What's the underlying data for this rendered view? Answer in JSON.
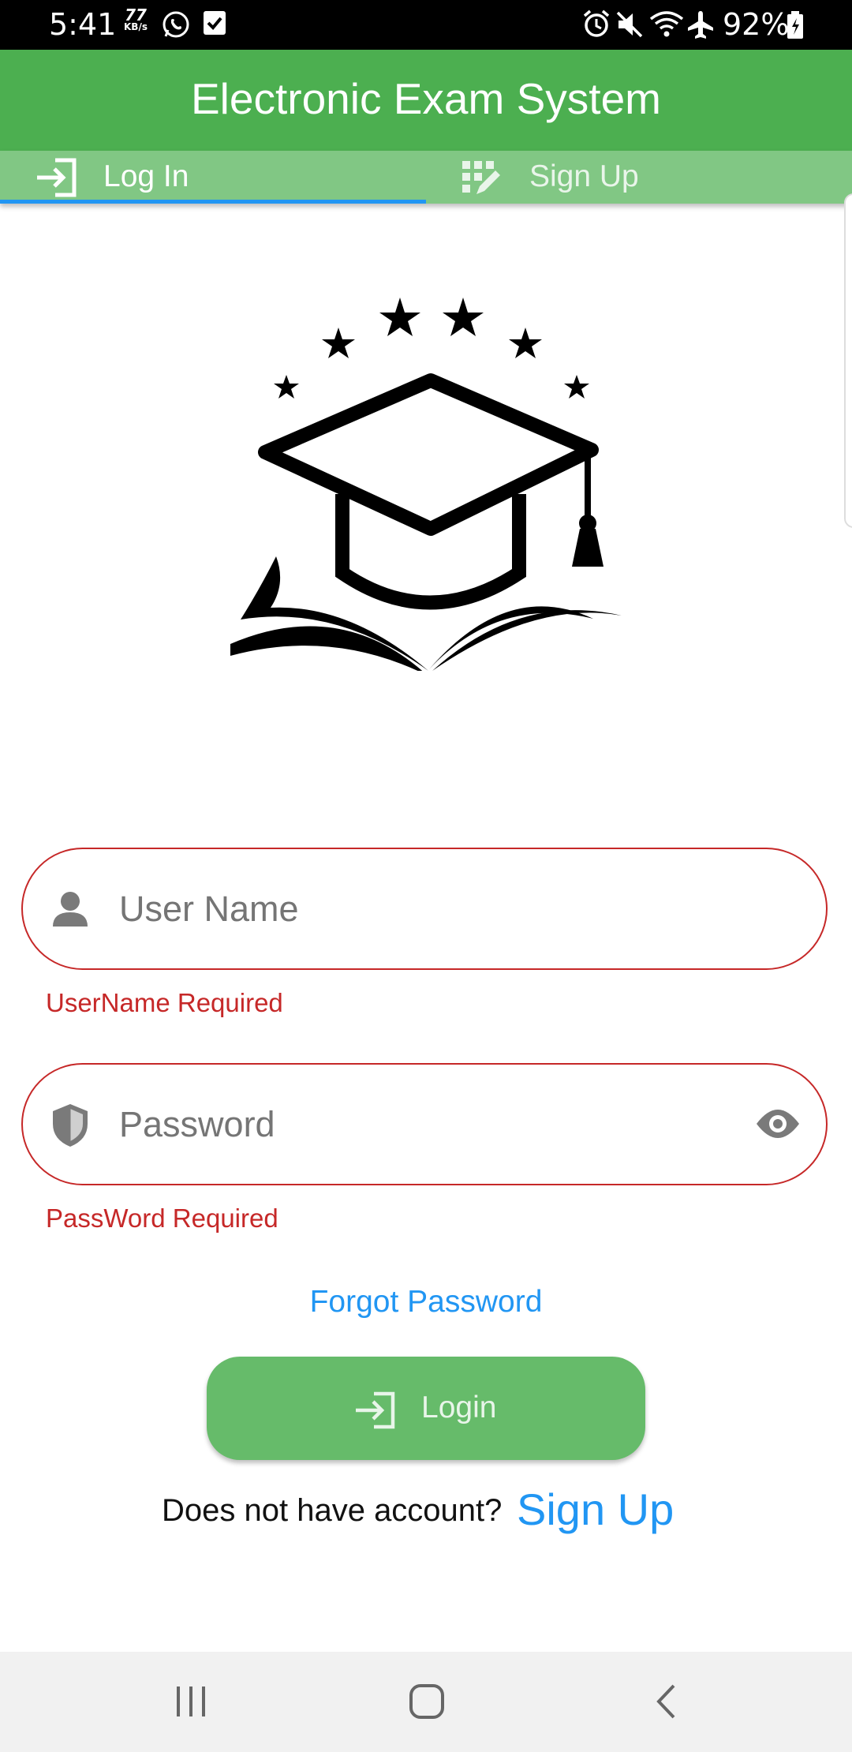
{
  "status_bar": {
    "time": "5:41",
    "net_speed_value": "77",
    "net_speed_unit": "KB/s",
    "battery_percent": "92%"
  },
  "app_bar": {
    "title": "Electronic Exam System"
  },
  "tabs": [
    {
      "label": "Log In",
      "icon": "login-icon",
      "selected": true
    },
    {
      "label": "Sign Up",
      "icon": "app-registration-icon",
      "selected": false
    }
  ],
  "form": {
    "username": {
      "placeholder": "User Name",
      "value": "",
      "error": "UserName Required"
    },
    "password": {
      "placeholder": "Password",
      "value": "",
      "error": "PassWord Required"
    },
    "forgot_label": "Forgot Password",
    "login_label": "Login",
    "account_prompt": "Does not have account?",
    "signup_label": "Sign Up"
  },
  "colors": {
    "primary": "#4caf50",
    "tab_bar": "#81c784",
    "button": "#66bb6a",
    "link": "#2196f3",
    "error": "#c62828",
    "indicator": "#2196f3"
  }
}
